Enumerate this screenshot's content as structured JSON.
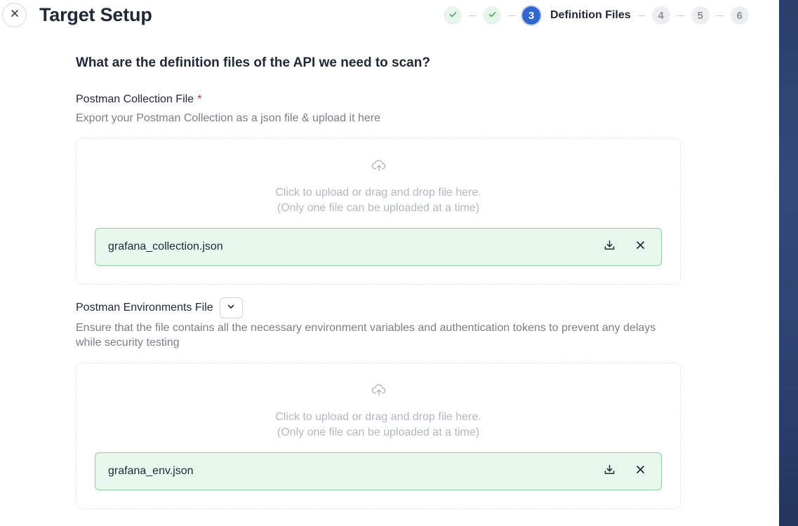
{
  "header": {
    "title": "Target Setup",
    "close_icon": "close-icon"
  },
  "stepper": {
    "steps": [
      {
        "number": "1",
        "status": "completed",
        "icon": "check-icon"
      },
      {
        "number": "2",
        "status": "completed",
        "icon": "check-icon"
      },
      {
        "number": "3",
        "status": "active",
        "label": "Definition Files"
      },
      {
        "number": "4",
        "status": "pending"
      },
      {
        "number": "5",
        "status": "pending"
      },
      {
        "number": "6",
        "status": "pending"
      }
    ]
  },
  "main": {
    "question": "What are the definition files of the API we need to scan?",
    "collection": {
      "label": "Postman Collection File",
      "required_marker": "*",
      "description": "Export your Postman Collection as a json file & upload it here",
      "dropzone_line1": "Click to upload or drag and drop file here.",
      "dropzone_line2": "(Only one file can be uploaded at a time)",
      "file_name": "grafana_collection.json"
    },
    "environments": {
      "label": "Postman Environments File",
      "description": "Ensure that the file contains all the necessary environment variables and authentication tokens to prevent any delays while security testing",
      "dropzone_line1": "Click to upload or drag and drop file here.",
      "dropzone_line2": "(Only one file can be uploaded at a time)",
      "file_name": "grafana_env.json"
    }
  },
  "colors": {
    "accent": "#2f66d0",
    "success_bg": "#e8f8ec",
    "success_border": "#8ed19c",
    "required": "#dc2626"
  }
}
